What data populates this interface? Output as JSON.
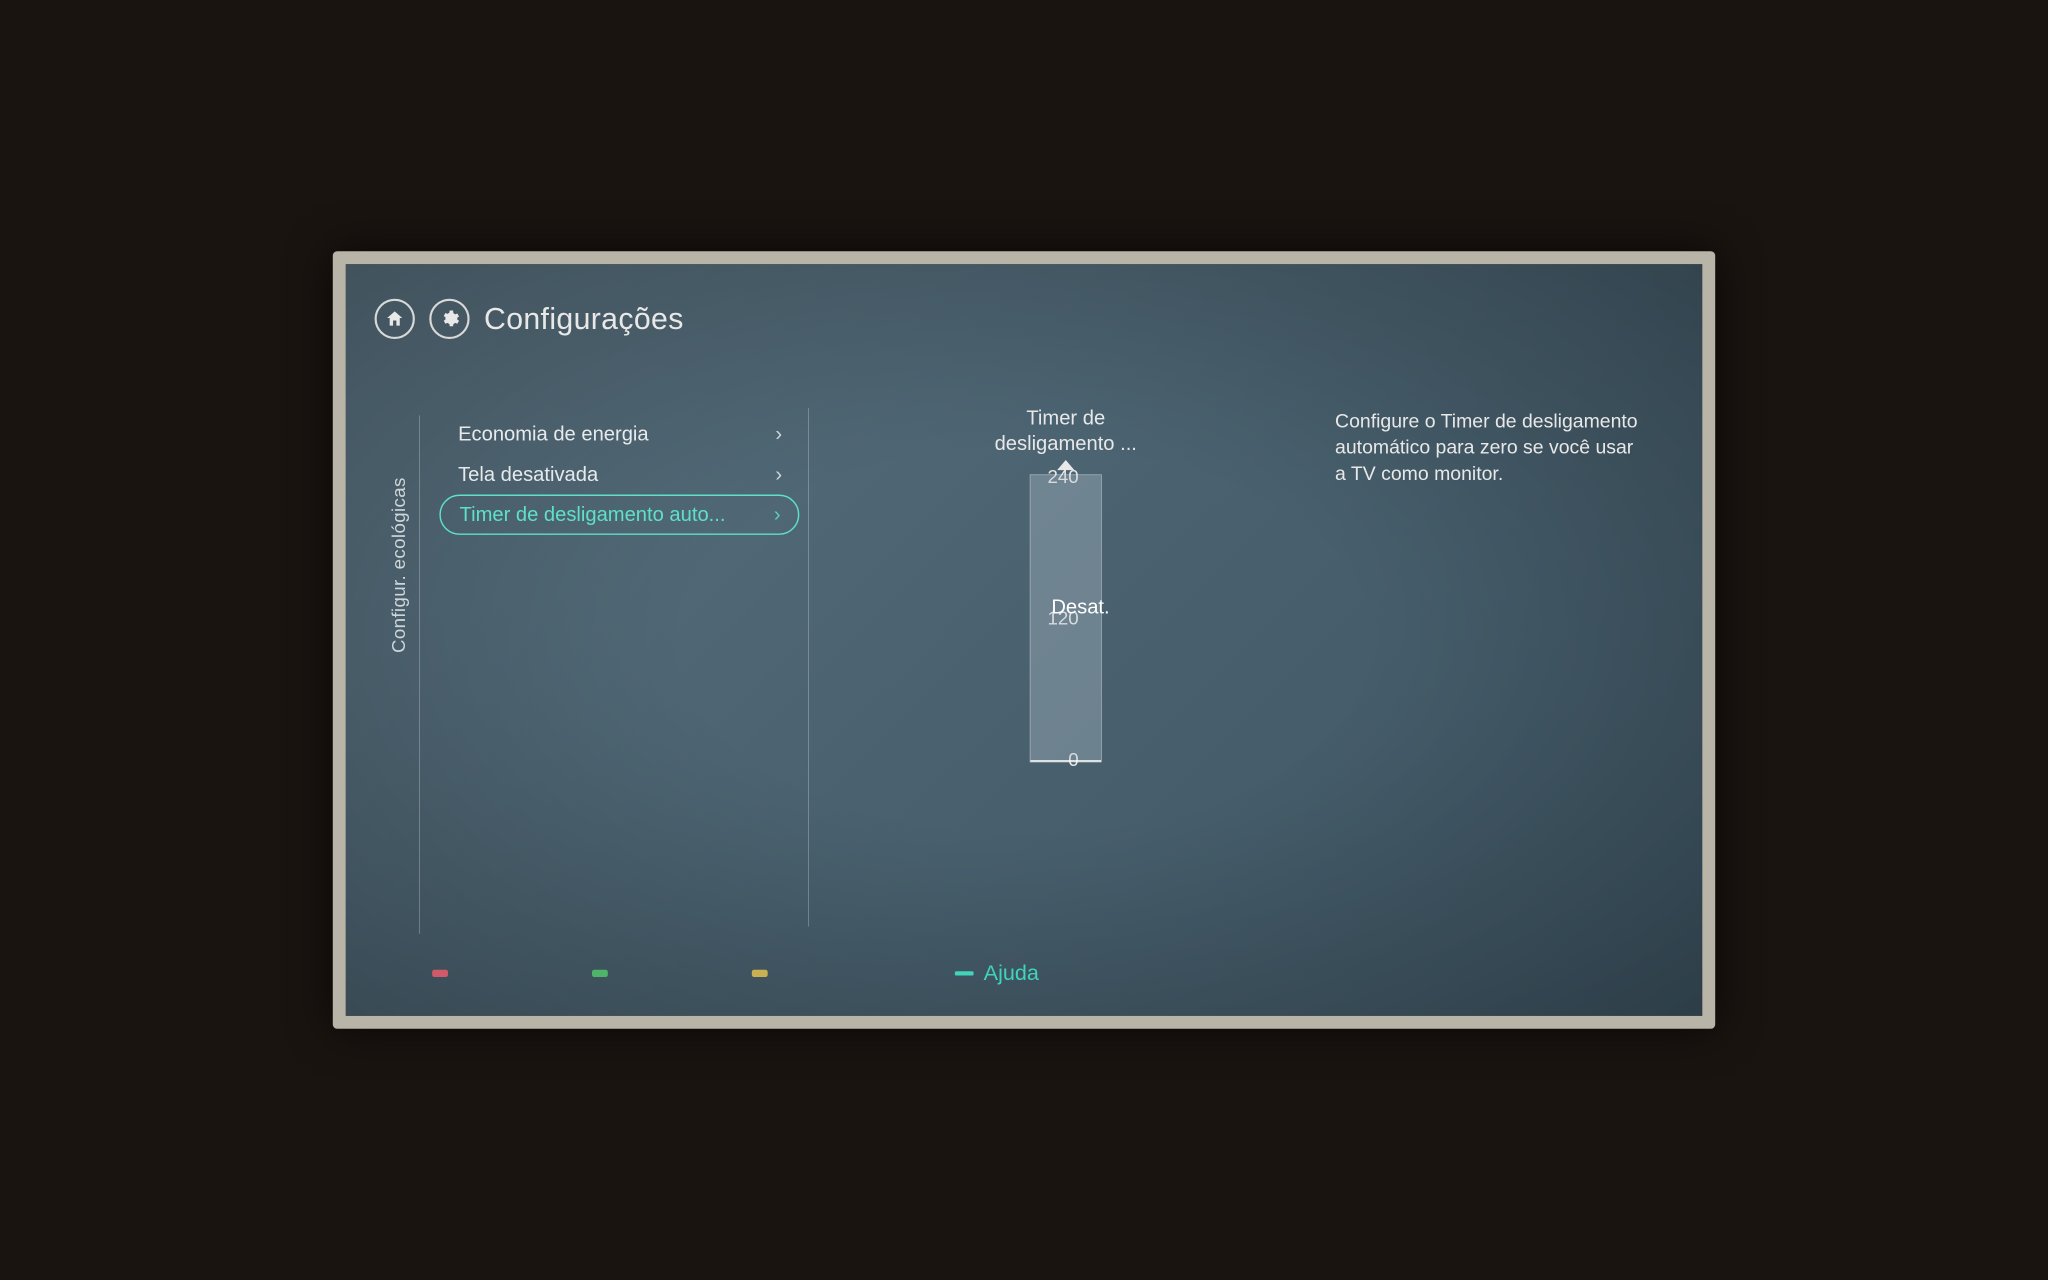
{
  "header": {
    "title": "Configurações"
  },
  "side_category": "Configur. ecológicas",
  "menu": {
    "items": [
      {
        "label": "Economia de energia",
        "selected": false
      },
      {
        "label": "Tela desativada",
        "selected": false
      },
      {
        "label": "Timer de desligamento auto...",
        "selected": true
      }
    ]
  },
  "slider": {
    "title_line1": "Timer de",
    "title_line2": "desligamento ...",
    "ticks": {
      "max": "240",
      "mid": "120",
      "min": "0"
    },
    "value_label": "Desat."
  },
  "description": "Configure o Timer de desligamento automático para zero se você usar a TV como monitor.",
  "footer": {
    "help_label": "Ajuda"
  }
}
